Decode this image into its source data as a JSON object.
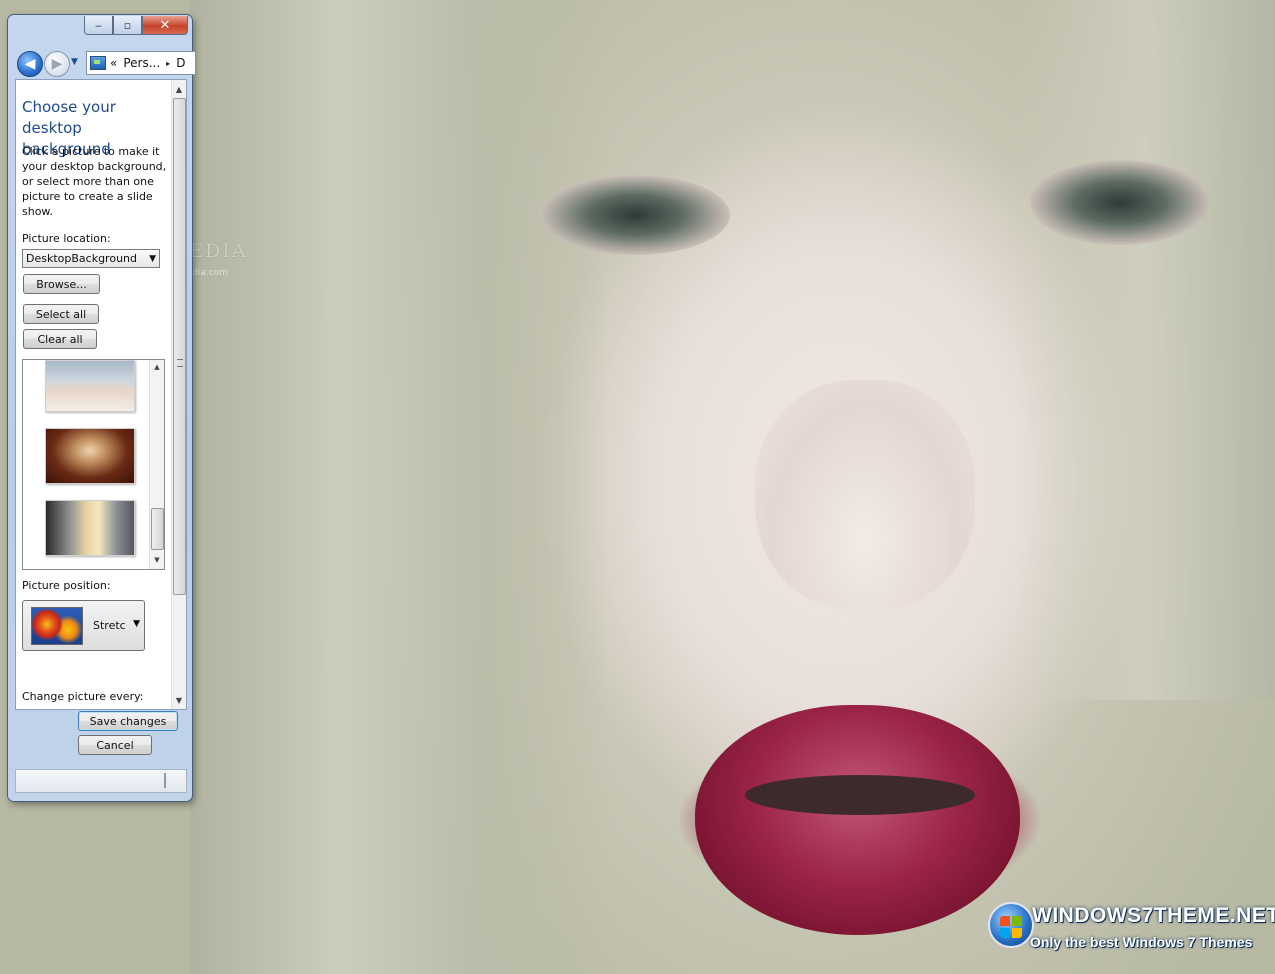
{
  "wallpaper": {
    "watermark_title": "WINDOWS7THEME.NET",
    "watermark_subtitle": "Only the best Windows 7 Themes",
    "softpedia": "SOFTPEDIA",
    "softpedia_sub": "www.softpedia.com"
  },
  "window": {
    "address_chevron": "«",
    "address_segment": "Pers...",
    "address_arrow": "▸",
    "address_next": "D",
    "heading": "Choose your desktop background",
    "description": "Click a picture to make it your desktop background, or select more than one picture to create a slide show.",
    "picture_location_label": "Picture location:",
    "picture_location_value": "DesktopBackground",
    "browse_label": "Browse...",
    "select_all_label": "Select all",
    "clear_all_label": "Clear all",
    "picture_position_label": "Picture position:",
    "picture_position_value": "Stretc",
    "cut_off_label": "Change picture every:",
    "save_label": "Save changes",
    "cancel_label": "Cancel"
  },
  "icons": {
    "minimize": "minimize-icon",
    "maximize": "maximize-icon",
    "close": "close-icon",
    "back": "back-arrow-icon",
    "forward": "forward-arrow-icon",
    "control_panel": "control-panel-icon",
    "dropdown": "chevron-down-icon"
  },
  "colors": {
    "heading": "#1e4a8e",
    "window_frame": "#b8cce6",
    "close_button": "#c7432b"
  }
}
